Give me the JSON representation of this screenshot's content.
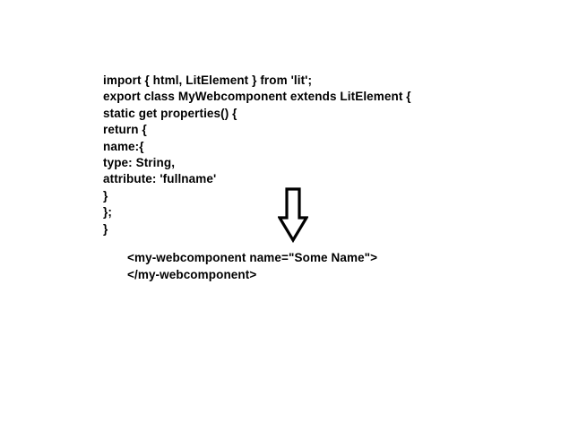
{
  "code_lines": [
    "import { html, LitElement } from 'lit';",
    "export class MyWebcomponent extends LitElement {",
    "static get properties() {",
    "return {",
    "name:{",
    "type: String,",
    "attribute: 'fullname'",
    "}",
    "};",
    "}"
  ],
  "usage_lines": [
    "<my-webcomponent name=\"Some Name\">",
    "</my-webcomponent>"
  ],
  "icons": {
    "arrow": "down-arrow-icon"
  }
}
